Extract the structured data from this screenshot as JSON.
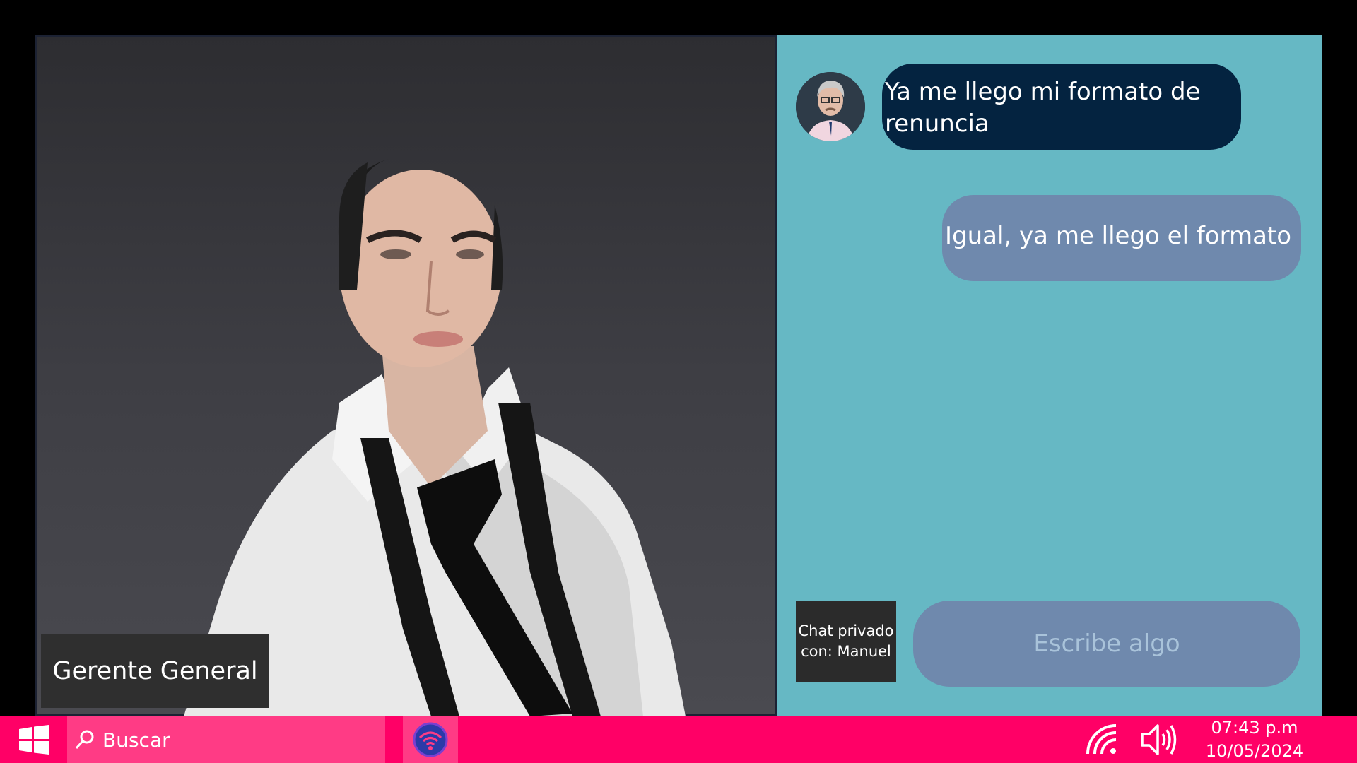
{
  "video": {
    "participant_role": "Gerente General"
  },
  "chat": {
    "messages": [
      {
        "direction": "incoming",
        "text": " Ya me llego mi formato de renuncia"
      },
      {
        "direction": "outgoing",
        "text": "Igual, ya me llego el formato"
      }
    ],
    "private_label_line1": "Chat privado",
    "private_label_line2": "con: Manuel",
    "input_placeholder": "Escribe algo",
    "input_value": ""
  },
  "taskbar": {
    "search_label": "Buscar",
    "time": "07:43 p.m",
    "date": "10/05/2024",
    "icons": [
      "windows-logo-icon",
      "search-icon",
      "wifi-app-icon",
      "wifi-signal-icon",
      "volume-icon"
    ]
  },
  "colors": {
    "taskbar": "#ff0066",
    "chat_background": "#66b8c4",
    "incoming_bubble": "#042340",
    "outgoing_bubble": "#6f89ad"
  }
}
